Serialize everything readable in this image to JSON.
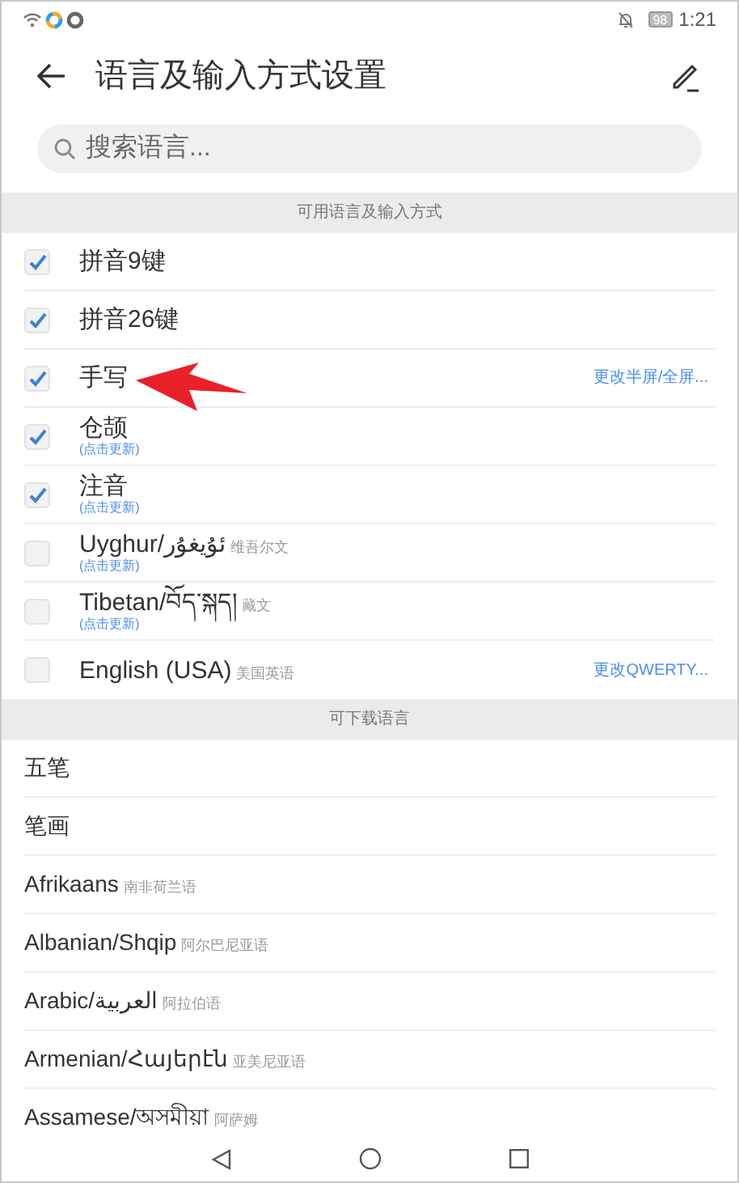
{
  "status_bar": {
    "battery": "98",
    "time": "1:21"
  },
  "header": {
    "title": "语言及输入方式设置"
  },
  "search": {
    "placeholder": "搜索语言..."
  },
  "sections": [
    {
      "title": "可用语言及输入方式",
      "kind": "installed",
      "items": [
        {
          "label": "拼音9键",
          "checked": true
        },
        {
          "label": "拼音26键",
          "checked": true
        },
        {
          "label": "手写",
          "checked": true,
          "action": "更改半屏/全屏..."
        },
        {
          "label": "仓颉",
          "checked": true,
          "note": "(点击更新)"
        },
        {
          "label": "注音",
          "checked": true,
          "note": "(点击更新)"
        },
        {
          "label": "Uyghur/ئۇيغۇر",
          "native": "维吾尔文",
          "checked": false,
          "note": "(点击更新)"
        },
        {
          "label": "Tibetan/བོད་སྐད།",
          "native": "藏文",
          "checked": false,
          "note": "(点击更新)"
        },
        {
          "label": "English (USA)",
          "native": "美国英语",
          "checked": false,
          "action": "更改QWERTY..."
        }
      ]
    },
    {
      "title": "可下载语言",
      "kind": "download",
      "items": [
        {
          "label": "五笔"
        },
        {
          "label": "笔画"
        },
        {
          "label": "Afrikaans",
          "native": "南非荷兰语"
        },
        {
          "label": "Albanian/Shqip",
          "native": "阿尔巴尼亚语"
        },
        {
          "label": "Arabic/العربية",
          "native": "阿拉伯语"
        },
        {
          "label": "Armenian/Հայերէն",
          "native": "亚美尼亚语"
        },
        {
          "label": "Assamese/অসমীয়া",
          "native": "阿萨姆"
        }
      ]
    }
  ]
}
